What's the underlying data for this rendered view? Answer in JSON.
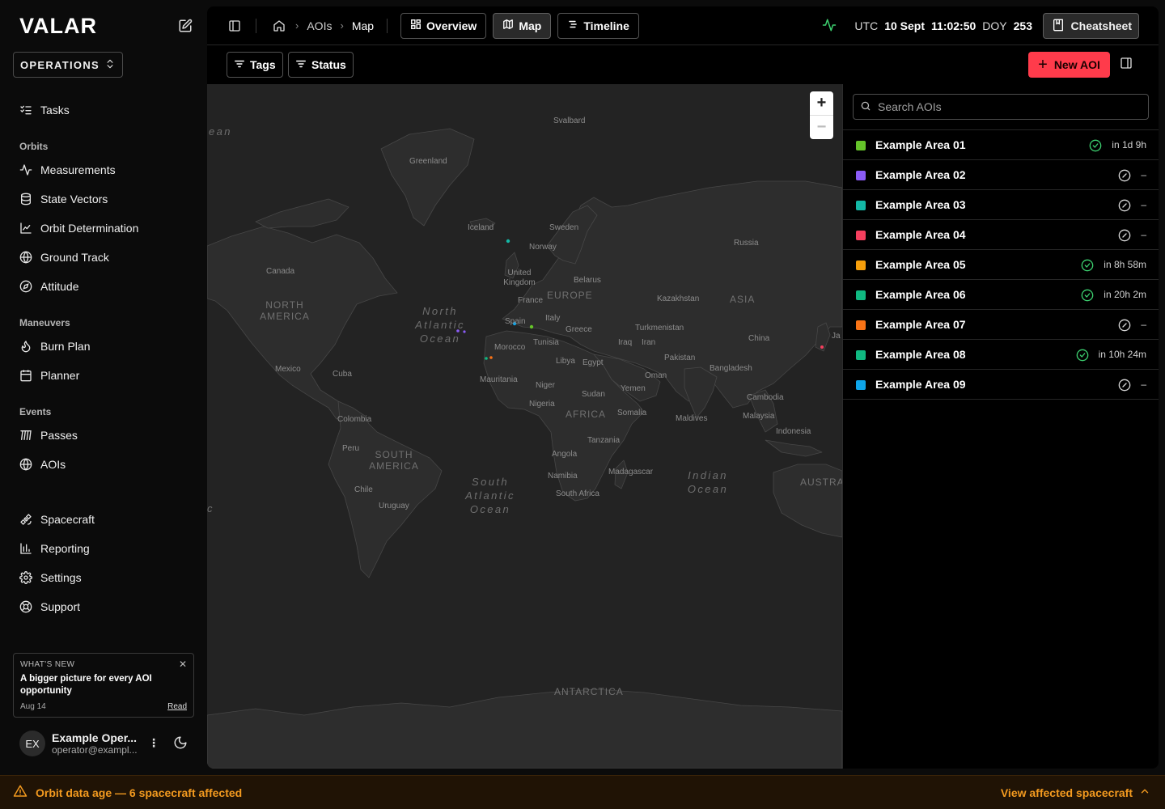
{
  "app": {
    "logo": "VALAR"
  },
  "workspace": {
    "selected": "OPERATIONS"
  },
  "nav": {
    "tasks": "Tasks",
    "orbits_heading": "Orbits",
    "measurements": "Measurements",
    "state_vectors": "State Vectors",
    "orbit_determination": "Orbit Determination",
    "ground_track": "Ground Track",
    "attitude": "Attitude",
    "maneuvers_heading": "Maneuvers",
    "burn_plan": "Burn Plan",
    "planner": "Planner",
    "events_heading": "Events",
    "passes": "Passes",
    "aois": "AOIs",
    "spacecraft": "Spacecraft",
    "reporting": "Reporting",
    "settings": "Settings",
    "support": "Support"
  },
  "whats_new": {
    "kicker": "WHAT'S NEW",
    "title": "A bigger picture for every AOI opportunity",
    "date": "Aug 14",
    "read": "Read"
  },
  "user": {
    "initials": "EX",
    "name": "Example Oper...",
    "email": "operator@exampl..."
  },
  "breadcrumb": {
    "items": [
      "AOIs",
      "Map"
    ]
  },
  "views": {
    "overview": "Overview",
    "map": "Map",
    "timeline": "Timeline",
    "active": "Map"
  },
  "clock": {
    "tz": "UTC",
    "date": "10 Sept",
    "time": "11:02:50",
    "doy_label": "DOY",
    "doy": "253"
  },
  "cheatsheet": "Cheatsheet",
  "filters": {
    "tags": "Tags",
    "status": "Status"
  },
  "new_aoi": "New AOI",
  "search": {
    "placeholder": "Search AOIs",
    "value": ""
  },
  "aois": [
    {
      "name": "Example Area 01",
      "color": "#65c32a",
      "status": "scheduled",
      "when": "in 1d 9h"
    },
    {
      "name": "Example Area 02",
      "color": "#8b5cf6",
      "status": "none",
      "when": "–"
    },
    {
      "name": "Example Area 03",
      "color": "#14b8a6",
      "status": "none",
      "when": "–"
    },
    {
      "name": "Example Area 04",
      "color": "#f43f5e",
      "status": "none",
      "when": "–"
    },
    {
      "name": "Example Area 05",
      "color": "#f59e0b",
      "status": "scheduled",
      "when": "in 8h 58m"
    },
    {
      "name": "Example Area 06",
      "color": "#10b981",
      "status": "scheduled",
      "when": "in 20h 2m"
    },
    {
      "name": "Example Area 07",
      "color": "#f97316",
      "status": "none",
      "when": "–"
    },
    {
      "name": "Example Area 08",
      "color": "#10b981",
      "status": "scheduled",
      "when": "in 10h 24m"
    },
    {
      "name": "Example Area 09",
      "color": "#0ea5e9",
      "status": "none",
      "when": "–"
    }
  ],
  "map": {
    "zoom_in": "+",
    "zoom_out": "−",
    "labels": {
      "svalbard": "Svalbard",
      "greenland": "Greenland",
      "iceland": "Iceland",
      "sweden": "Sweden",
      "norway": "Norway",
      "russia": "Russia",
      "canada": "Canada",
      "uk": "United Kingdom",
      "belarus": "Belarus",
      "france": "France",
      "kazakhstan": "Kazakhstan",
      "spain": "Spain",
      "italy": "Italy",
      "greece": "Greece",
      "turkmenistan": "Turkmenistan",
      "china": "China",
      "morocco": "Morocco",
      "tunisia": "Tunisia",
      "iraq": "Iraq",
      "iran": "Iran",
      "pakistan": "Pakistan",
      "libya": "Libya",
      "egypt": "Egypt",
      "bangladesh": "Bangladesh",
      "mexico": "Mexico",
      "cuba": "Cuba",
      "oman": "Oman",
      "mauritania": "Mauritania",
      "yemen": "Yemen",
      "niger": "Niger",
      "cambodia": "Cambodia",
      "sudan": "Sudan",
      "nigeria": "Nigeria",
      "malaysia": "Malaysia",
      "colombia": "Colombia",
      "somalia": "Somalia",
      "maldives": "Maldives",
      "indonesia": "Indonesia",
      "peru": "Peru",
      "tanzania": "Tanzania",
      "angola": "Angola",
      "madagascar": "Madagascar",
      "namibia": "Namibia",
      "south_africa": "South Africa",
      "chile": "Chile",
      "uruguay": "Uruguay",
      "ja": "Ja"
    },
    "regions": {
      "north_america": "NORTH AMERICA",
      "europe": "EUROPE",
      "asia": "ASIA",
      "africa": "AFRICA",
      "south_america": "SOUTH AMERICA",
      "australia": "AUSTRA",
      "antarctica": "ANTARCTICA"
    },
    "oceans": {
      "north_atlantic": "North Atlantic Ocean",
      "south_atlantic": "South Atlantic Ocean",
      "indian": "Indian Ocean",
      "edge_left": "ean",
      "edge_c": "c"
    }
  },
  "banner": {
    "message": "Orbit data age — 6 spacecraft affected",
    "action": "View affected spacecraft"
  }
}
